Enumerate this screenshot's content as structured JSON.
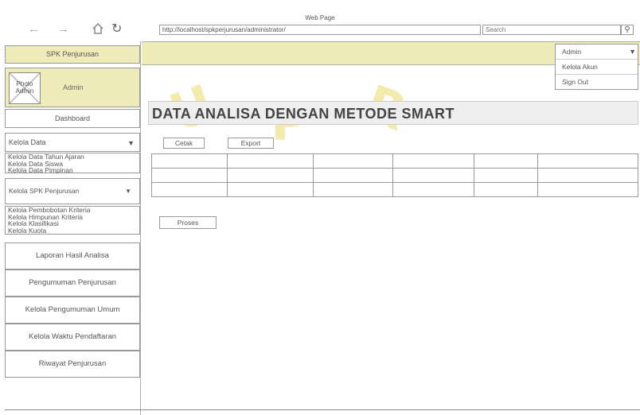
{
  "browser": {
    "title": "Web Page",
    "url": "http://localhost/spkperjurusan/administrator/",
    "search_placeholder": "Search"
  },
  "watermark": [
    "U",
    "P",
    "R"
  ],
  "sidebar": {
    "brand": "SPK Penjurusan",
    "photo_label": "Photo\nAdmin",
    "user_name": "Admin",
    "dashboard": "Dashboard",
    "kelola_data": "Kelola Data",
    "kelola_data_items": [
      "Kelola Data Tahun Ajaran",
      "Kelola Data Siswa",
      "Kelola Data Pimpinan"
    ],
    "kelola_spk": "Kelola SPK Penjurusan",
    "kelola_spk_items": [
      "Kelola Pembobotan Kriteria",
      "Kelola Himpunan Kriteria",
      "Kelola Klasifikasi",
      "Kelola Kuota"
    ],
    "menu": [
      "Laporan Hasil Analisa",
      "Pengumuman Penjurusan",
      "Kelola Pengumuman Umum",
      "Kelola Waktu Pendaftaran",
      "Riwayat Penjurusan"
    ]
  },
  "user_menu": {
    "selected": "Admin",
    "items": [
      "Kelola Akun",
      "Sign Out"
    ]
  },
  "main": {
    "title": "DATA ANALISA DENGAN METODE SMART",
    "cetak_label": "Cetak",
    "export_label": "Export",
    "proses_label": "Proses",
    "table_rows": [
      [
        "",
        "",
        "",
        "",
        "",
        ""
      ],
      [
        "",
        "",
        "",
        "",
        "",
        ""
      ],
      [
        "",
        "",
        "",
        "",
        "",
        ""
      ]
    ]
  }
}
